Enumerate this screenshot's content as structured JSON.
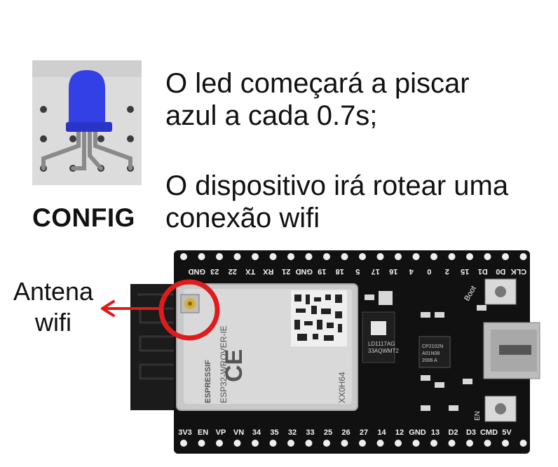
{
  "led_panel": {
    "label": "CONFIG",
    "led_color": "#3340e6"
  },
  "description": {
    "line1": "O led começará a piscar",
    "line2": "azul a cada 0.7s;",
    "line3": "O dispositivo irá rotear uma",
    "line4": "conexão wifi"
  },
  "antenna_callout": {
    "line1": "Antena",
    "line2": "wifi",
    "color": "#e01b1b"
  },
  "board": {
    "module_brand": "ESPRESSIF",
    "module_model": "ESP32-WROVER-IE",
    "module_code": "XX0H64",
    "regulator_line1": "LD1117AG",
    "regulator_line2": "33AQWMT2",
    "usb_chip_line1": "CP2102N",
    "usb_chip_line2": "A01N08",
    "usb_chip_line3": "2006 A",
    "boot_label": "Boot",
    "en_label": "EN",
    "top_pins": [
      "GND",
      "23",
      "22",
      "TX",
      "RX",
      "21",
      "GND",
      "19",
      "18",
      "5",
      "17",
      "16",
      "4",
      "0",
      "2",
      "15",
      "D1",
      "D0",
      "CLK"
    ],
    "bottom_pins": [
      "3V3",
      "EN",
      "VP",
      "VN",
      "34",
      "35",
      "32",
      "33",
      "25",
      "26",
      "27",
      "14",
      "12",
      "GND",
      "13",
      "D2",
      "D3",
      "CMD",
      "5V"
    ]
  }
}
